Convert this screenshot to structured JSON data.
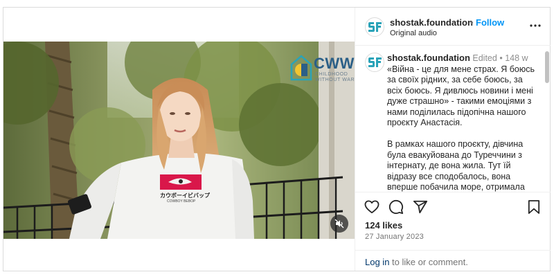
{
  "post": {
    "username": "shostak.foundation",
    "follow_label": "Follow",
    "separator": "•",
    "audio": "Original audio",
    "avatar_logo": "SF",
    "more_icon": "more-horizontal-icon"
  },
  "media": {
    "watermark": {
      "title": "CWW",
      "subtitle_line1": "CHILDHOOD",
      "subtitle_line2": "WITHOUT WAR"
    },
    "shirt_print_jp": "カウボーイビバップ",
    "shirt_print_en": "COWBOY BEBOP",
    "mute_icon": "speaker-muted-icon"
  },
  "caption": {
    "username": "shostak.foundation",
    "edited": "Edited",
    "separator": "•",
    "age": "148 w",
    "paragraph1": "«Війна - це для мене страх. Я боюсь за своїх рідних, за себе боюсь, за всіх боюсь. Я дивлюсь новини і мені дуже страшно» - такими емоціями з нами поділилась підопічна нашого проєкту Анастасія.",
    "paragraph2": "В рамках нашого проєкту, дівчина була евакуйована до Туреччини з інтернату, де вона жила. Тут їй відразу все сподобалось,  вона вперше побачила море, отримала"
  },
  "actions": {
    "like_icon": "heart-icon",
    "comment_icon": "comment-icon",
    "share_icon": "paper-plane-icon",
    "save_icon": "bookmark-icon"
  },
  "stats": {
    "likes": "124 likes",
    "date": "27 January 2023"
  },
  "footer": {
    "login_label": "Log in",
    "login_suffix": " to like or comment."
  },
  "colors": {
    "accent": "#0095f6",
    "link": "#00376b",
    "brand_teal": "#2aa3b8",
    "muted": "#737373"
  }
}
